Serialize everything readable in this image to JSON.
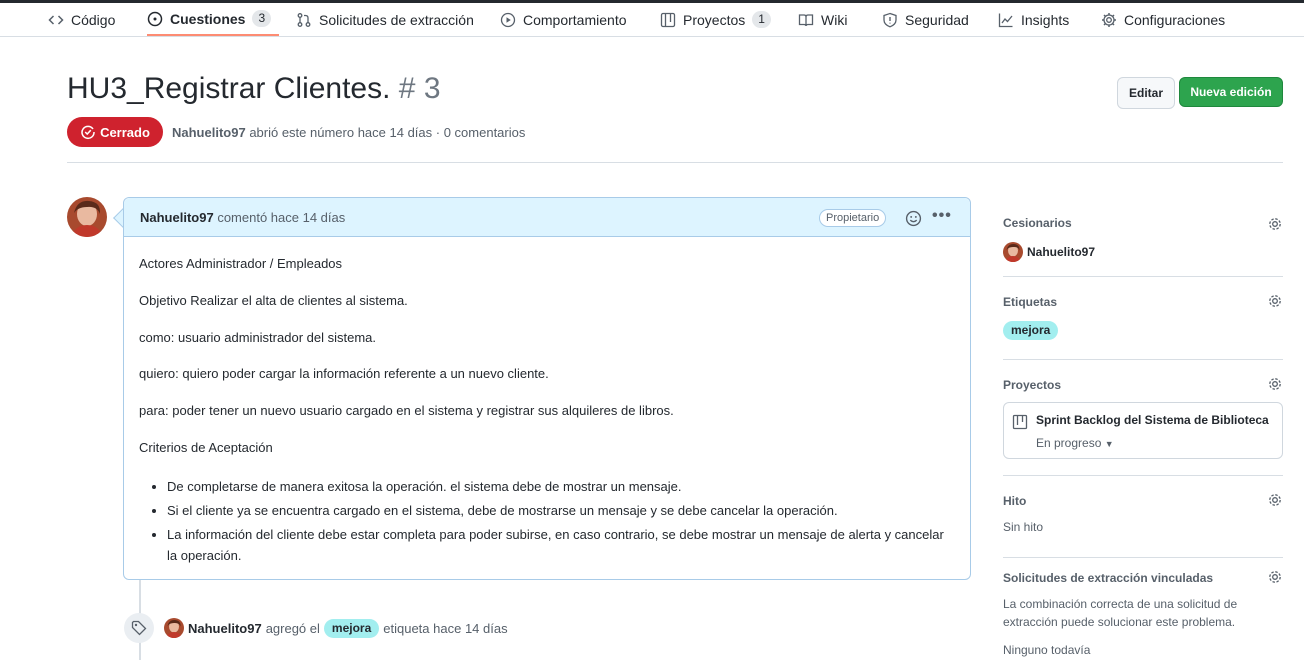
{
  "nav": {
    "items": [
      {
        "label": "Código",
        "icon": "code-icon"
      },
      {
        "label": "Cuestiones",
        "icon": "issue-opened-icon",
        "count": "3",
        "active": true
      },
      {
        "label": "Solicitudes de extracción",
        "icon": "git-pull-request-icon"
      },
      {
        "label": "Comportamiento",
        "icon": "play-icon"
      },
      {
        "label": "Proyectos",
        "icon": "table-icon",
        "count": "1"
      },
      {
        "label": "Wiki",
        "icon": "book-icon"
      },
      {
        "label": "Seguridad",
        "icon": "shield-icon"
      },
      {
        "label": "Insights",
        "icon": "graph-icon"
      },
      {
        "label": "Configuraciones",
        "icon": "gear-icon"
      }
    ]
  },
  "issue": {
    "title": "HU3_Registrar Clientes.",
    "number": "# 3",
    "edit_label": "Editar",
    "new_label": "Nueva edición",
    "state": "Cerrado",
    "author": "Nahuelito97",
    "meta": "abrió este número hace 14 días · 0 comentarios"
  },
  "comment": {
    "author": "Nahuelito97",
    "time": "comentó hace 14 días",
    "owner_badge": "Propietario",
    "paragraphs": [
      "Actores Administrador / Empleados",
      "Objetivo Realizar el alta de clientes al sistema.",
      "como: usuario administrador del sistema.",
      "quiero: quiero poder cargar la información referente a un nuevo cliente.",
      "para: poder tener un nuevo usuario cargado en el sistema y registrar sus alquileres de libros.",
      "Criterios de Aceptación"
    ],
    "bullets": [
      "De completarse de manera exitosa la operación. el sistema debe de mostrar un mensaje.",
      "Si el cliente ya se encuentra cargado en el sistema, debe de mostrarse un mensaje y se debe cancelar la operación.",
      "La información del cliente debe estar completa para poder subirse, en caso contrario, se debe mostrar un mensaje de alerta y cancelar la operación."
    ]
  },
  "timeline": {
    "author": "Nahuelito97",
    "action": "agregó el",
    "label": "mejora",
    "suffix": "etiqueta hace 14 días"
  },
  "sidebar": {
    "assignees_title": "Cesionarios",
    "assignee": "Nahuelito97",
    "labels_title": "Etiquetas",
    "label": "mejora",
    "projects_title": "Proyectos",
    "project_name": "Sprint Backlog del Sistema de Biblioteca",
    "project_status": "En progreso",
    "milestone_title": "Hito",
    "milestone_value": "Sin hito",
    "linked_title": "Solicitudes de extracción vinculadas",
    "linked_desc_1": "La combinación correcta de una solicitud de",
    "linked_desc_2": "extracción puede solucionar este problema.",
    "linked_none": "Ninguno todavía"
  },
  "colors": {
    "closed": "#cf222e",
    "primary": "#2da44e",
    "label_bg": "#a2eeef",
    "comment_header": "#ddf4ff"
  }
}
